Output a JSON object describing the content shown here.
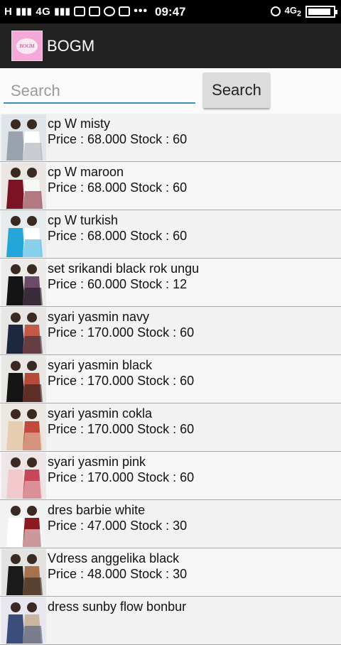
{
  "status_bar": {
    "network_left": "H",
    "network_mid": "4G",
    "time": "09:47",
    "network_right": "4G",
    "sim_label": "2",
    "battery_level": 0.9
  },
  "app": {
    "title": "BOGM",
    "logo_text": "BOGM"
  },
  "search": {
    "placeholder": "Search",
    "button_label": "Search"
  },
  "products": [
    {
      "name": "cp W misty",
      "price_stock": "Price : 68.000 Stock : 60",
      "colors": [
        "#dfe4ea",
        "#9aa3ad",
        "#ffffff"
      ]
    },
    {
      "name": "cp W maroon",
      "price_stock": "Price : 68.000 Stock : 60",
      "colors": [
        "#e9e6e4",
        "#7a1424",
        "#f7f7f7"
      ]
    },
    {
      "name": "cp W turkish",
      "price_stock": "Price : 68.000 Stock : 60",
      "colors": [
        "#e6ebee",
        "#24a7d8",
        "#ffffff"
      ]
    },
    {
      "name": "set srikandi black rok ungu",
      "price_stock": "Price : 60.000 Stock : 12",
      "colors": [
        "#ecebe9",
        "#141414",
        "#6b4a6a"
      ]
    },
    {
      "name": "syari yasmin navy",
      "price_stock": "Price : 170.000 Stock : 60",
      "colors": [
        "#e8e6e4",
        "#1e2740",
        "#c25a4a"
      ]
    },
    {
      "name": "syari yasmin black",
      "price_stock": "Price : 170.000 Stock : 60",
      "colors": [
        "#e9e7e4",
        "#151515",
        "#b34a3a"
      ]
    },
    {
      "name": "syari yasmin cokla",
      "price_stock": "Price : 170.000 Stock : 60",
      "colors": [
        "#ece7e1",
        "#e6cdb0",
        "#c14a3c"
      ]
    },
    {
      "name": "syari yasmin pink",
      "price_stock": "Price : 170.000 Stock : 60",
      "colors": [
        "#eee6e6",
        "#f1c9cd",
        "#c4485a"
      ]
    },
    {
      "name": "dres barbie white",
      "price_stock": "Price : 47.000 Stock : 30",
      "colors": [
        "#f2f2f2",
        "#ffffff",
        "#8a1a20"
      ]
    },
    {
      "name": "Vdress anggelika black",
      "price_stock": "Price : 48.000 Stock : 30",
      "colors": [
        "#e4e2e0",
        "#1a1a1a",
        "#a7734f"
      ]
    },
    {
      "name": "dress sunby flow bonbur",
      "price_stock": "",
      "colors": [
        "#e8e6ee",
        "#3b4d7a",
        "#c9b6a0"
      ]
    }
  ]
}
